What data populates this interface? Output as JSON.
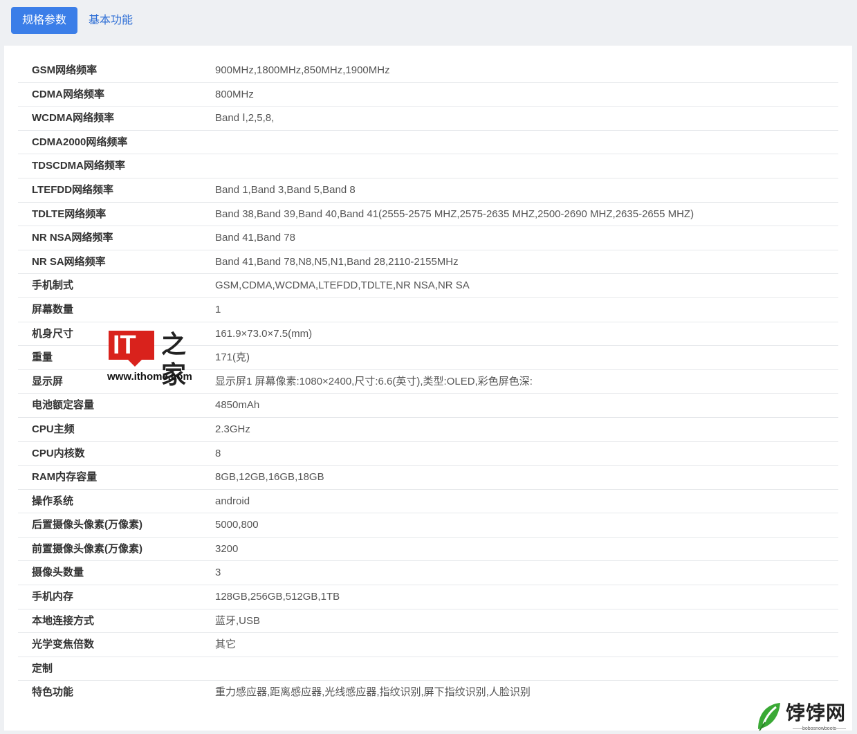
{
  "tabs": {
    "active_label": "规格参数",
    "other_label": "基本功能"
  },
  "specs": [
    {
      "label": "GSM网络频率",
      "value": "900MHz,1800MHz,850MHz,1900MHz"
    },
    {
      "label": "CDMA网络频率",
      "value": "800MHz"
    },
    {
      "label": "WCDMA网络频率",
      "value": "Band Ⅰ,2,5,8,"
    },
    {
      "label": "CDMA2000网络频率",
      "value": ""
    },
    {
      "label": "TDSCDMA网络频率",
      "value": ""
    },
    {
      "label": "LTEFDD网络频率",
      "value": "Band 1,Band 3,Band 5,Band 8"
    },
    {
      "label": "TDLTE网络频率",
      "value": "Band 38,Band 39,Band 40,Band 41(2555-2575 MHZ,2575-2635 MHZ,2500-2690 MHZ,2635-2655 MHZ)"
    },
    {
      "label": "NR NSA网络频率",
      "value": "Band 41,Band 78"
    },
    {
      "label": "NR SA网络频率",
      "value": "Band 41,Band 78,N8,N5,N1,Band 28,2110-2155MHz"
    },
    {
      "label": "手机制式",
      "value": "GSM,CDMA,WCDMA,LTEFDD,TDLTE,NR NSA,NR SA"
    },
    {
      "label": "屏幕数量",
      "value": "1"
    },
    {
      "label": "机身尺寸",
      "value": "161.9×73.0×7.5(mm)"
    },
    {
      "label": "重量",
      "value": "171(克)"
    },
    {
      "label": "显示屏",
      "value": "显示屏1 屏幕像素:1080×2400,尺寸:6.6(英寸),类型:OLED,彩色屏色深:"
    },
    {
      "label": "电池额定容量",
      "value": "4850mAh"
    },
    {
      "label": "CPU主频",
      "value": "2.3GHz"
    },
    {
      "label": "CPU内核数",
      "value": "8"
    },
    {
      "label": "RAM内存容量",
      "value": "8GB,12GB,16GB,18GB"
    },
    {
      "label": "操作系统",
      "value": "android"
    },
    {
      "label": "后置摄像头像素(万像素)",
      "value": "5000,800"
    },
    {
      "label": "前置摄像头像素(万像素)",
      "value": "3200"
    },
    {
      "label": "摄像头数量",
      "value": "3"
    },
    {
      "label": "手机内存",
      "value": "128GB,256GB,512GB,1TB"
    },
    {
      "label": "本地连接方式",
      "value": "蓝牙,USB"
    },
    {
      "label": "光学变焦倍数",
      "value": "其它"
    },
    {
      "label": "定制",
      "value": ""
    },
    {
      "label": "特色功能",
      "value": "重力感应器,距离感应器,光线感应器,指纹识别,屏下指纹识别,人脸识别"
    }
  ],
  "watermark": {
    "brand": "IT",
    "glyph": "之家",
    "url": "www.ithome.com"
  },
  "corner_logo": {
    "text": "饽饽网",
    "subtext": "——bobosnowboots——"
  },
  "colors": {
    "accent": "#3b7ee8",
    "watermark_red": "#d9221c",
    "logo_green": "#3aa935"
  }
}
